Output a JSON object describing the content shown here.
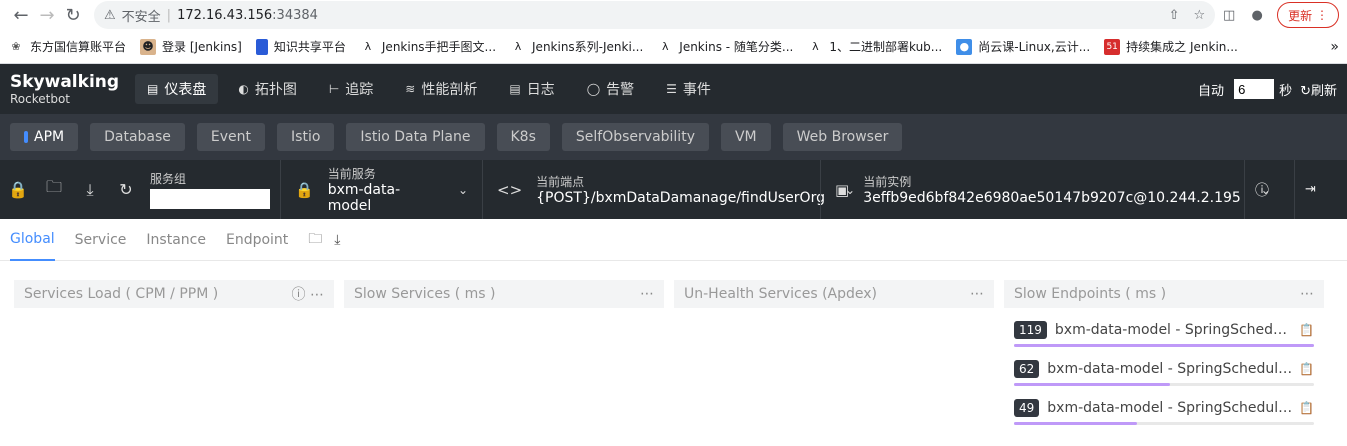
{
  "browser": {
    "address": {
      "insecure": "不安全",
      "host": "172.16.43.156",
      "port": ":34384"
    },
    "update_label": "更新",
    "bookmarks": [
      {
        "label": "东方国信算账平台",
        "icon": "bookmark-icon"
      },
      {
        "label": "登录 [Jenkins]",
        "icon": "jenkins-icon"
      },
      {
        "label": "知识共享平台",
        "icon": "bookmark-icon"
      },
      {
        "label": "Jenkins手把手图文...",
        "icon": "csdn-icon"
      },
      {
        "label": "Jenkins系列-Jenki...",
        "icon": "csdn-icon"
      },
      {
        "label": "Jenkins - 随笔分类...",
        "icon": "csdn-icon"
      },
      {
        "label": "1、二进制部署kub...",
        "icon": "csdn-icon"
      },
      {
        "label": "尚云课-Linux,云计...",
        "icon": "bookmark-icon"
      },
      {
        "label": "持续集成之 Jenkin...",
        "icon": "51cto-icon"
      }
    ]
  },
  "app": {
    "logo_line1": "Skywalking",
    "logo_line2": "Rocketbot",
    "nav": [
      {
        "label": "仪表盘",
        "icon": "dashboard-icon"
      },
      {
        "label": "拓扑图",
        "icon": "topology-icon"
      },
      {
        "label": "追踪",
        "icon": "trace-icon"
      },
      {
        "label": "性能剖析",
        "icon": "profile-icon"
      },
      {
        "label": "日志",
        "icon": "log-icon"
      },
      {
        "label": "告警",
        "icon": "alarm-icon"
      },
      {
        "label": "事件",
        "icon": "event-icon"
      }
    ],
    "auto_label": "自动",
    "auto_value": "6",
    "seconds_label": "秒",
    "refresh_label": "刷新",
    "tabs": [
      "APM",
      "Database",
      "Event",
      "Istio",
      "Istio Data Plane",
      "K8s",
      "SelfObservability",
      "VM",
      "Web Browser"
    ],
    "selectors": {
      "group": {
        "title": "服务组",
        "value": ""
      },
      "service": {
        "title": "当前服务",
        "value": "bxm-data-model"
      },
      "endpoint": {
        "title": "当前端点",
        "value": "{POST}/bxmDataDamanage/findUserOrg"
      },
      "instance": {
        "title": "当前实例",
        "value": "3effb9ed6bf842e6980ae50147b9207c@10.244.2.195"
      }
    },
    "dash_tabs": [
      "Global",
      "Service",
      "Instance",
      "Endpoint"
    ],
    "panels": [
      {
        "title": "Services Load ( CPM / PPM )"
      },
      {
        "title": "Slow Services ( ms )"
      },
      {
        "title": "Un-Health Services (Apdex)"
      },
      {
        "title": "Slow Endpoints ( ms )"
      }
    ],
    "slow_endpoints": [
      {
        "value": "119",
        "name": "bxm-data-model - SpringScheduled/...",
        "fraction": 1.0
      },
      {
        "value": "62",
        "name": "bxm-data-model - SpringScheduled/c...",
        "fraction": 0.52
      },
      {
        "value": "49",
        "name": "bxm-data-model - SpringScheduled/c...",
        "fraction": 0.41
      }
    ]
  }
}
